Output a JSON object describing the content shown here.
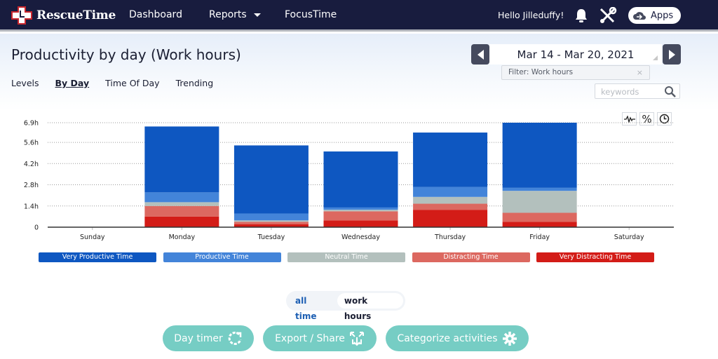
{
  "topbar": {
    "brand": "RescueTime",
    "nav": [
      {
        "label": "Dashboard"
      },
      {
        "label": "Reports",
        "has_dropdown": true
      },
      {
        "label": "FocusTime"
      }
    ],
    "greeting": "Hello Jilleduffy!",
    "icons": [
      "bell-icon",
      "tools-icon"
    ],
    "apps_label": "Apps"
  },
  "page": {
    "title": "Productivity by day (Work hours)",
    "tabs": [
      {
        "label": "Levels",
        "active": false
      },
      {
        "label": "By Day",
        "active": true
      },
      {
        "label": "Time Of Day",
        "active": false
      },
      {
        "label": "Trending",
        "active": false
      }
    ],
    "date_range": "Mar 14 - Mar 20, 2021",
    "filter_label": "Filter: Work hours",
    "filter_clear": "×",
    "keywords_placeholder": "keywords",
    "chart_view_buttons": [
      "trend-icon",
      "%",
      "clock-icon"
    ]
  },
  "colors": {
    "very_productive": "#0e57c1",
    "productive": "#4384d9",
    "neutral": "#b3c0bd",
    "distracting": "#dc6860",
    "very_distracting": "#d31c17",
    "teal_button": "#76cdc4",
    "nav_bg": "#181c3e"
  },
  "chart_data": {
    "type": "bar",
    "stacked": true,
    "title": "Productivity by day (Work hours)",
    "xlabel": "",
    "ylabel": "",
    "categories": [
      "Sunday",
      "Monday",
      "Tuesday",
      "Wednesday",
      "Thursday",
      "Friday",
      "Saturday"
    ],
    "y_ticks": [
      "0",
      "1.4h",
      "2.8h",
      "4.2h",
      "5.6h",
      "6.9h"
    ],
    "y_tick_values": [
      0,
      1.4,
      2.8,
      4.2,
      5.6,
      6.9
    ],
    "ylim": [
      0,
      6.9
    ],
    "grid": true,
    "legend_position": "bottom",
    "series": [
      {
        "name": "Very Distracting Time",
        "color": "#d31c17",
        "values": [
          0,
          0.7,
          0.2,
          0.45,
          1.15,
          0.35
        ]
      },
      {
        "name": "Distracting Time",
        "color": "#dc6860",
        "values": [
          0,
          0.7,
          0.15,
          0.6,
          0.4,
          0.6
        ]
      },
      {
        "name": "Neutral Time",
        "color": "#b3c0bd",
        "values": [
          0,
          0.25,
          0.1,
          0.1,
          0.45,
          1.45
        ]
      },
      {
        "name": "Productive Time",
        "color": "#4384d9",
        "values": [
          0,
          0.65,
          0.45,
          0.15,
          0.65,
          0.2
        ]
      },
      {
        "name": "Very Productive Time",
        "color": "#0e57c1",
        "values": [
          0,
          4.35,
          4.5,
          3.7,
          3.6,
          4.3
        ]
      }
    ]
  },
  "legend": [
    {
      "label": "Very Productive Time",
      "color": "#0e57c1"
    },
    {
      "label": "Productive Time",
      "color": "#4384d9"
    },
    {
      "label": "Neutral Time",
      "color": "#b3c0bd"
    },
    {
      "label": "Distracting Time",
      "color": "#dc6860"
    },
    {
      "label": "Very Distracting Time",
      "color": "#d31c17"
    }
  ],
  "hours_toggle": {
    "options": [
      "all time",
      "work hours"
    ],
    "selected": "work hours"
  },
  "actions": [
    {
      "label": "Day timer",
      "icon": "refresh-icon"
    },
    {
      "label": "Export / Share",
      "icon": "export-icon"
    },
    {
      "label": "Categorize activities",
      "icon": "gear-icon"
    }
  ]
}
